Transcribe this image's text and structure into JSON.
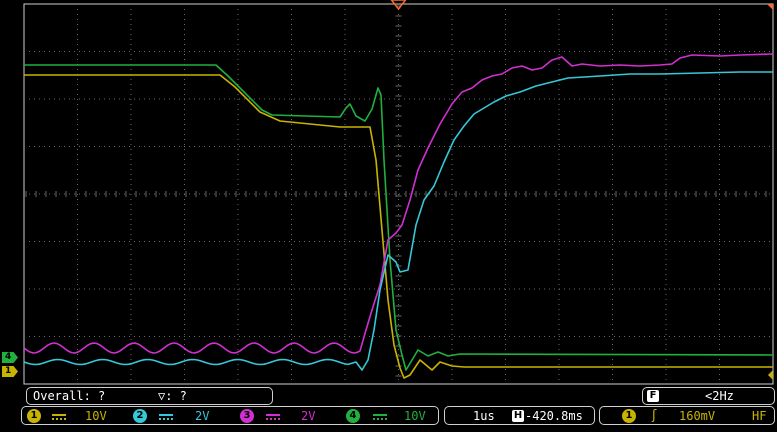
{
  "colors": {
    "ch1": "#c8b400",
    "ch2": "#35c8d8",
    "ch3": "#d030d0",
    "ch4": "#20b040",
    "grid": "#6a6a6a",
    "frame": "#cfcfcf",
    "trigger_marker": "#ff6a2a"
  },
  "markers": {
    "ch4": "4",
    "ch1": "1"
  },
  "measure": {
    "overall": "Overall: ?",
    "cursor": "▽: ?"
  },
  "frequency": {
    "mode": "F",
    "value": "<2Hz"
  },
  "channels": [
    {
      "id": "1",
      "coupling_icon": "dc-coupling-icon",
      "scale": "10V"
    },
    {
      "id": "2",
      "coupling_icon": "dc-coupling-icon",
      "scale": "2V"
    },
    {
      "id": "3",
      "coupling_icon": "dc-coupling-icon",
      "scale": "2V"
    },
    {
      "id": "4",
      "coupling_icon": "dc-coupling-icon",
      "scale": "10V"
    }
  ],
  "timebase": {
    "scale": "1us",
    "h_icon": "H",
    "position": "-420.8ms"
  },
  "trigger": {
    "source": "1",
    "slope_icon": "rising-edge-icon",
    "slope_glyph": "ʃ",
    "level": "160mV",
    "filter": "HF"
  }
}
